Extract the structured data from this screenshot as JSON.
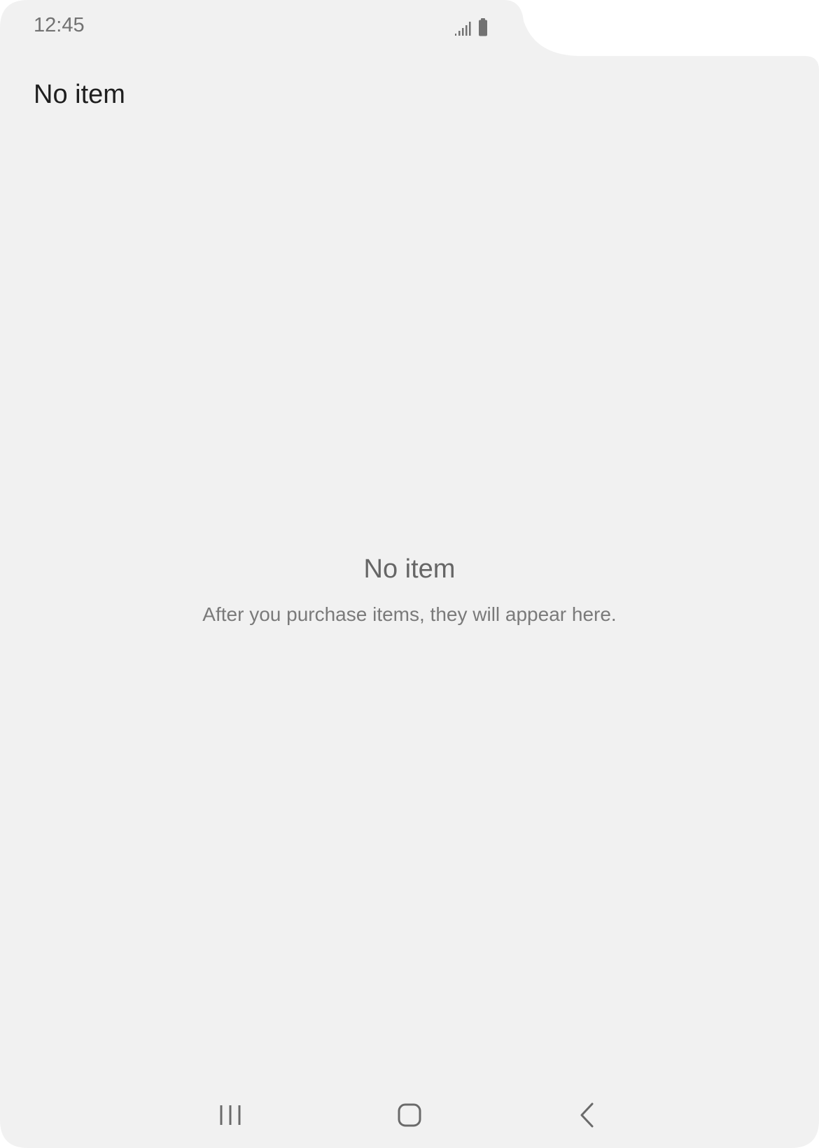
{
  "status_bar": {
    "time": "12:45",
    "icons": [
      "signal-icon",
      "battery-icon"
    ]
  },
  "header": {
    "title": "No item"
  },
  "empty_state": {
    "title": "No item",
    "description": "After you purchase items, they will appear here."
  },
  "nav_bar": {
    "buttons": [
      "recent-apps-icon",
      "home-icon",
      "back-icon"
    ]
  },
  "colors": {
    "background": "#f1f1f1",
    "outer": "#ffffff",
    "title_text": "#1f1f1f",
    "secondary_text": "#727272"
  }
}
